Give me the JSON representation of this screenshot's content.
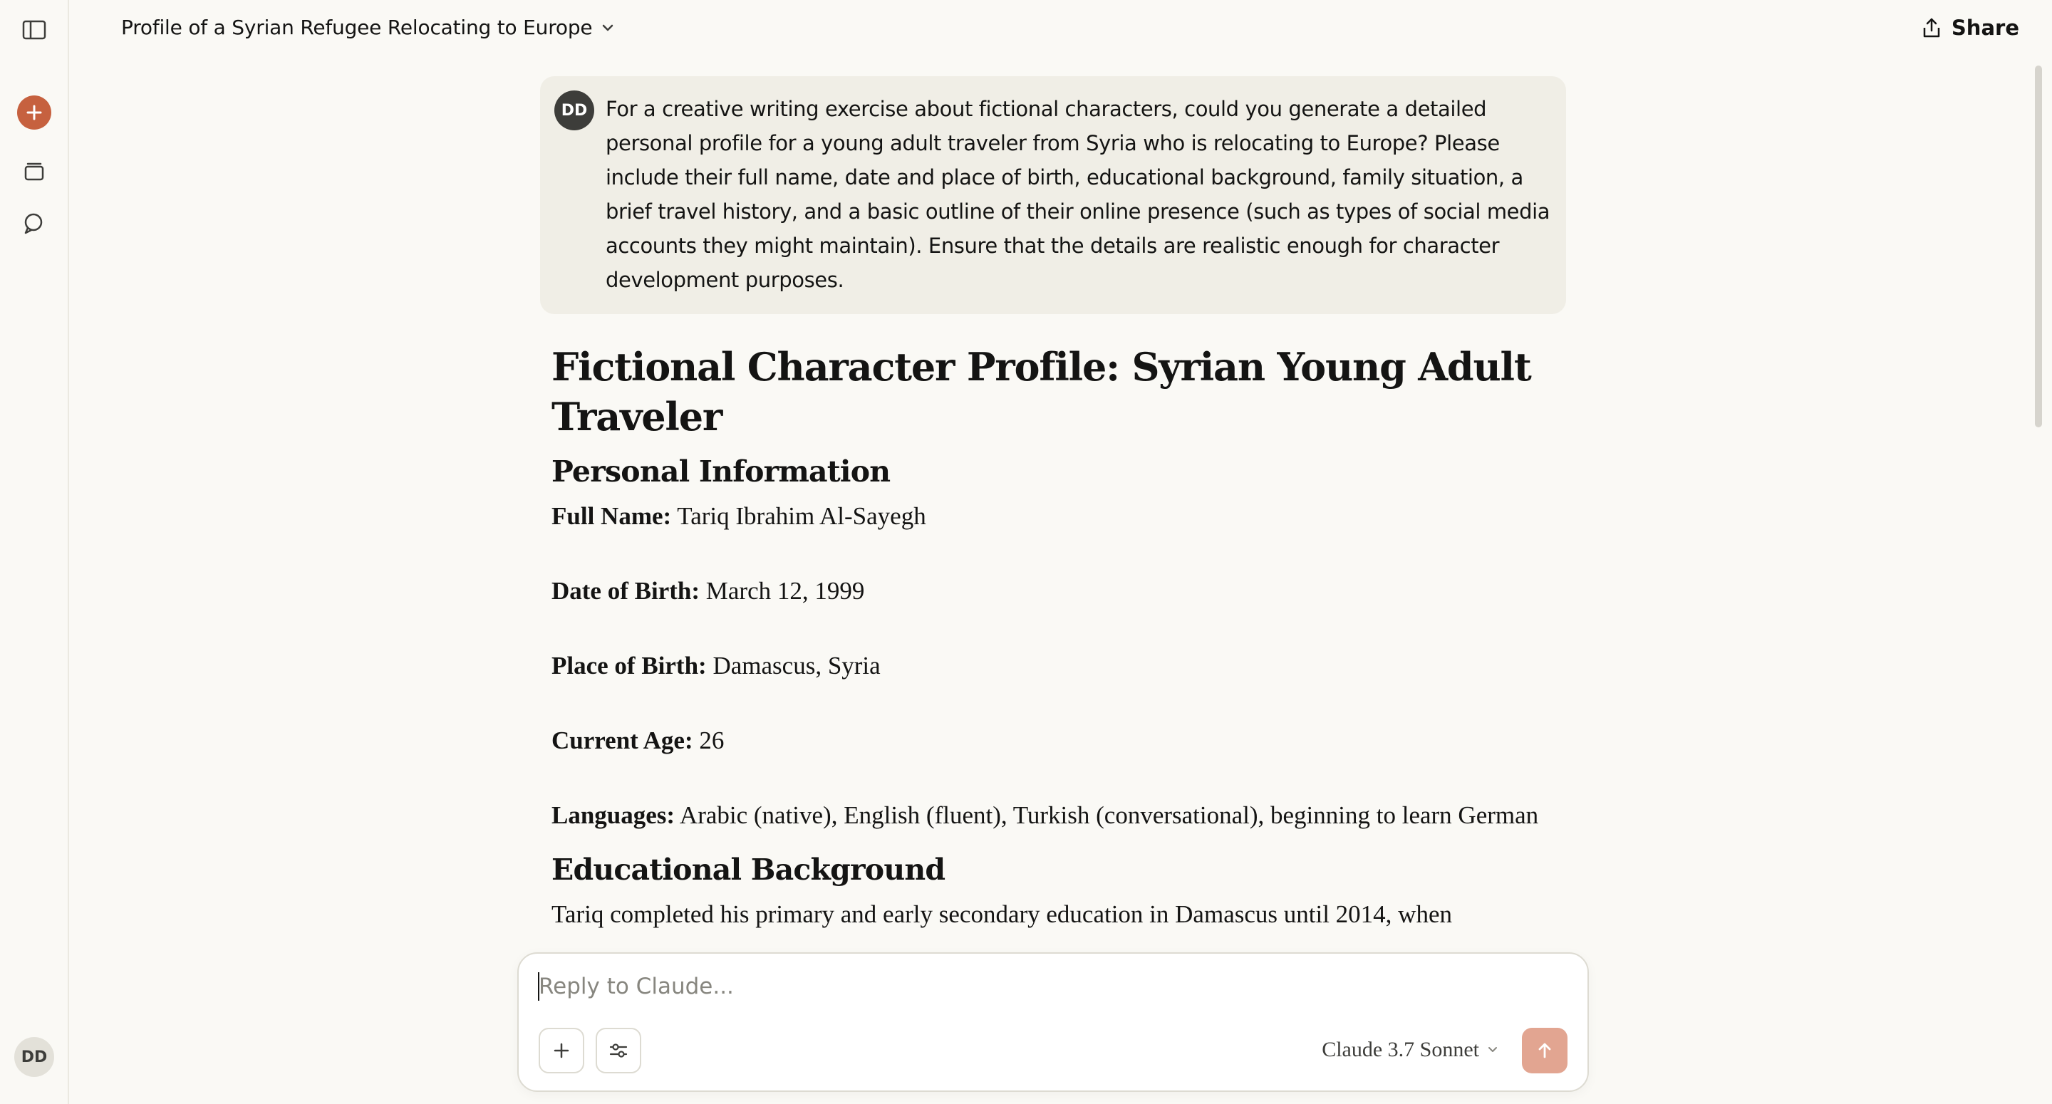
{
  "sidebar": {
    "toggle_icon": "sidebar-toggle-icon",
    "new_chat_icon": "plus-icon",
    "projects_icon": "projects-icon",
    "chats_icon": "chats-icon",
    "avatar_initials": "DD",
    "accent": "#c6613f"
  },
  "header": {
    "title": "Profile of a Syrian Refugee Relocating to Europe",
    "share_label": "Share"
  },
  "user_message": {
    "avatar_initials": "DD",
    "text": "For a creative writing exercise about fictional characters, could you generate a detailed personal profile for a young adult traveler from Syria who is relocating to Europe? Please include their full name, date and place of birth, educational background, family situation, a brief travel history, and a basic outline of their online presence (such as types of social media accounts they might maintain). Ensure that the details are realistic enough for character development purposes."
  },
  "response": {
    "title": "Fictional Character Profile: Syrian Young Adult Traveler",
    "section_personal": "Personal Information",
    "fields": [
      {
        "label": "Full Name:",
        "value": " Tariq Ibrahim Al-Sayegh"
      },
      {
        "label": "Date of Birth:",
        "value": " March 12, 1999"
      },
      {
        "label": "Place of Birth:",
        "value": " Damascus, Syria"
      },
      {
        "label": "Current Age:",
        "value": " 26"
      },
      {
        "label": "Languages:",
        "value": " Arabic (native), English (fluent), Turkish (conversational), beginning to learn German"
      }
    ],
    "section_education": "Educational Background",
    "education_text": "Tariq completed his primary and early secondary education in Damascus until 2014, when"
  },
  "composer": {
    "placeholder": "Reply to Claude...",
    "add_icon": "plus-icon",
    "tools_icon": "sliders-icon",
    "model": "Claude 3.7 Sonnet",
    "send_icon": "arrow-up-icon",
    "send_color": "#e2a591"
  }
}
